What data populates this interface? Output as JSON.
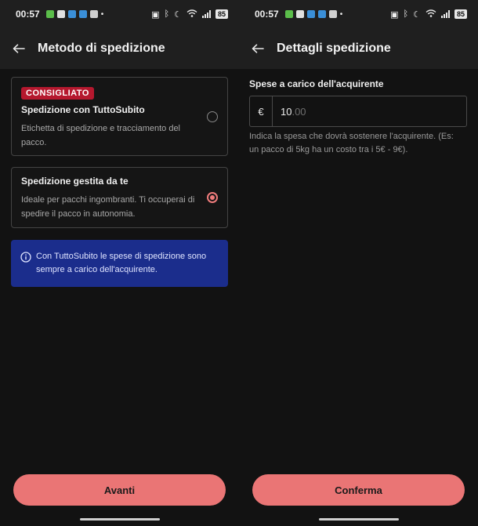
{
  "status_bar": {
    "time": "00:57",
    "battery": "85"
  },
  "left": {
    "title": "Metodo di spedizione",
    "option_tuttosubito": {
      "badge": "CONSIGLIATO",
      "title": "Spedizione con TuttoSubito",
      "description": "Etichetta di spedizione e tracciamento del pacco.",
      "selected": false
    },
    "option_self": {
      "title": "Spedizione gestita da te",
      "description": "Ideale per pacchi ingombranti. Ti occuperai di spedire il pacco in autonomia.",
      "selected": true
    },
    "info_text": "Con TuttoSubito le spese di spedizione sono sempre a carico dell'acquirente.",
    "button_label": "Avanti"
  },
  "right": {
    "title": "Dettagli spedizione",
    "field_label": "Spese a carico dell'acquirente",
    "currency": "€",
    "price_value": "10",
    "price_decimals": ".00",
    "hint": "Indica la spesa che dovrà sostenere l'acquirente. (Es: un pacco di 5kg ha un costo tra i 5€ - 9€).",
    "button_label": "Conferma"
  },
  "colors": {
    "accent": "#ea7575",
    "badge": "#b5182e",
    "info_bg": "#1b2d8c",
    "background": "#121212"
  }
}
